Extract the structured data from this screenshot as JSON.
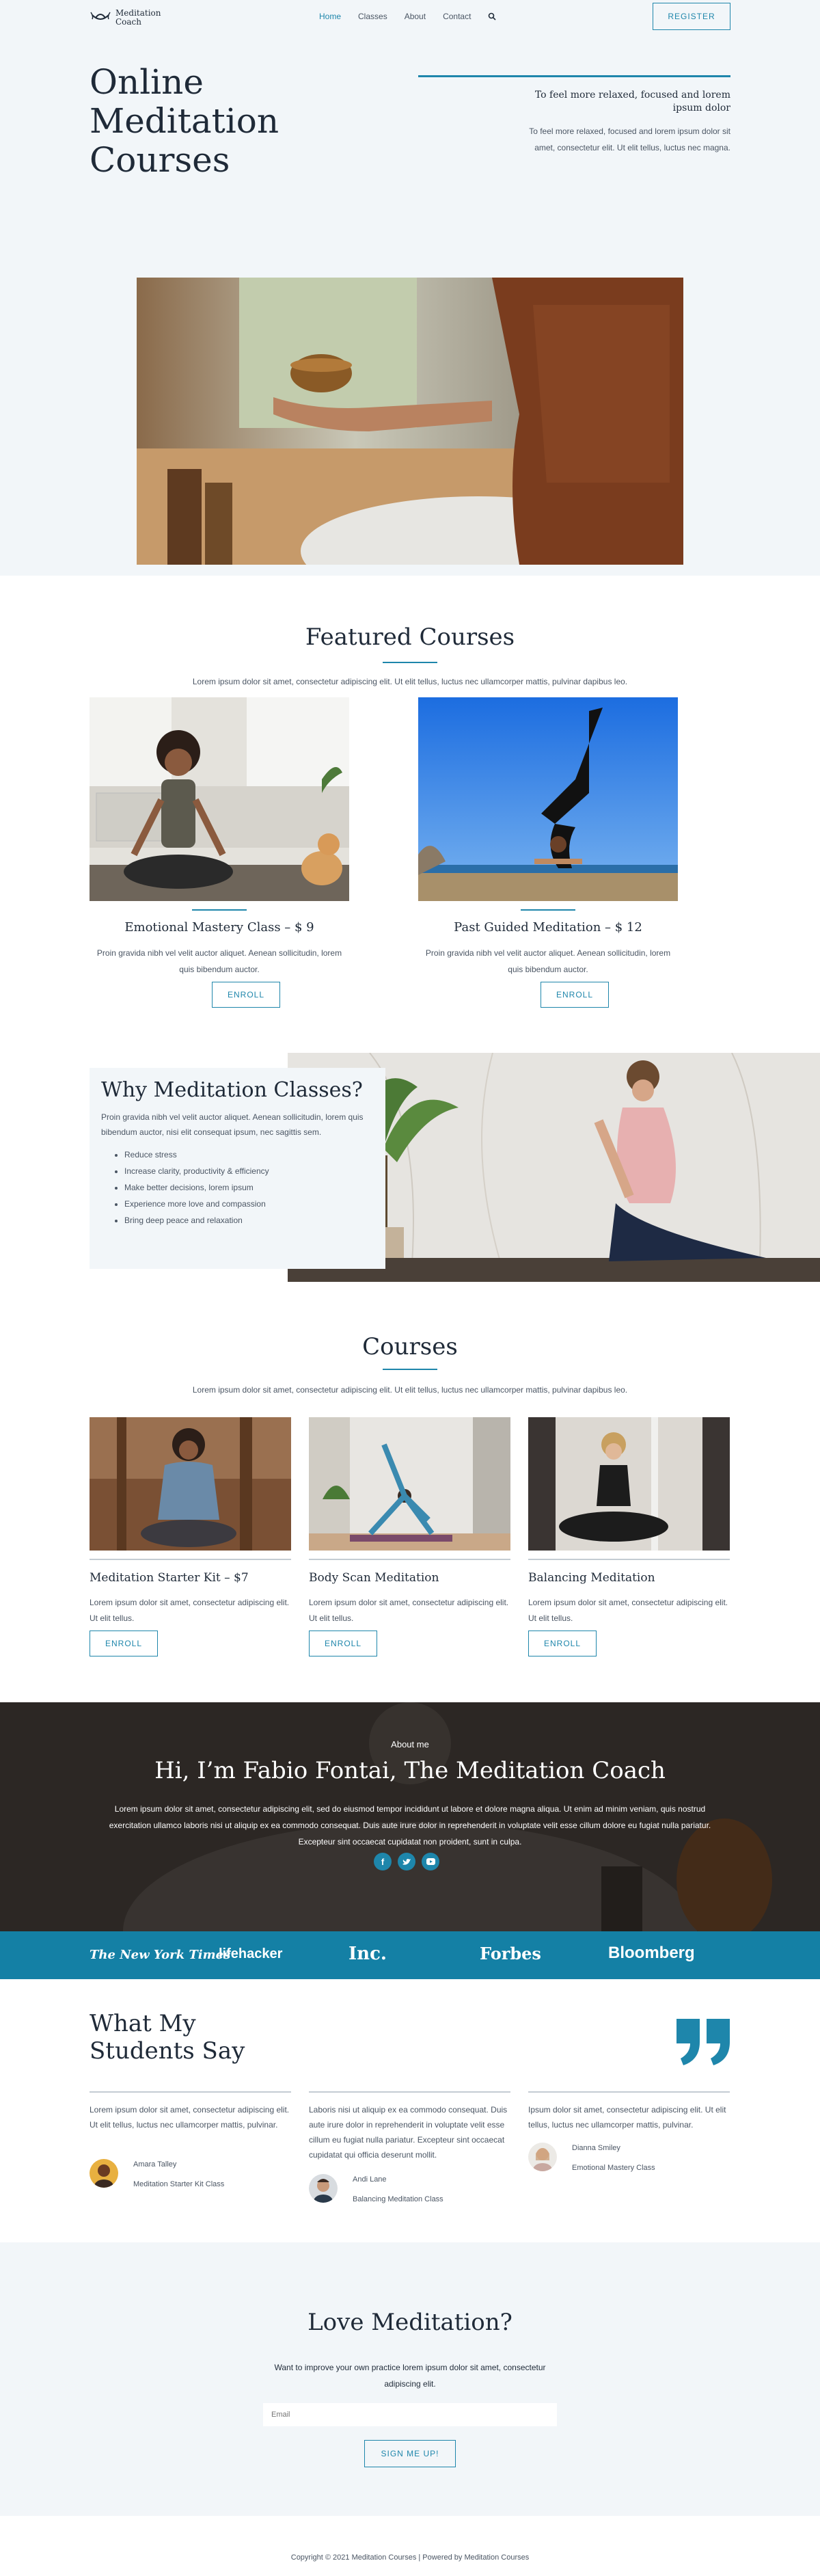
{
  "header": {
    "logo_line1": "Meditation",
    "logo_line2": "Coach",
    "nav": [
      "Home",
      "Classes",
      "About",
      "Contact"
    ],
    "register_label": "REGISTER"
  },
  "hero": {
    "title": "Online Meditation Courses",
    "subtitle": "To feel more relaxed, focused and lorem ipsum dolor",
    "description": "To feel more relaxed, focused and lorem ipsum dolor sit amet, consectetur elit. Ut elit tellus, luctus nec magna."
  },
  "featured": {
    "title": "Featured Courses",
    "text": "Lorem ipsum dolor sit amet, consectetur adipiscing elit. Ut elit tellus, luctus nec ullamcorper mattis, pulvinar dapibus leo.",
    "items": [
      {
        "title": "Emotional Mastery Class – $ 9",
        "desc": "Proin gravida nibh vel velit auctor aliquet. Aenean sollicitudin, lorem quis bibendum auctor.",
        "button": "ENROLL"
      },
      {
        "title": "Past Guided Meditation – $ 12",
        "desc": "Proin gravida nibh vel velit auctor aliquet. Aenean sollicitudin, lorem quis bibendum auctor.",
        "button": "ENROLL"
      }
    ]
  },
  "why": {
    "title": "Why Meditation Classes?",
    "text": "Proin gravida nibh vel velit auctor aliquet. Aenean sollicitudin, lorem quis bibendum auctor, nisi elit consequat ipsum, nec sagittis sem.",
    "list": [
      "Reduce stress",
      "Increase clarity, productivity & efficiency",
      "Make better decisions, lorem ipsum",
      "Experience more love and compassion",
      "Bring deep peace and relaxation"
    ]
  },
  "courses": {
    "title": "Courses",
    "text": "Lorem ipsum dolor sit amet, consectetur adipiscing elit. Ut elit tellus, luctus nec ullamcorper mattis, pulvinar dapibus leo.",
    "items": [
      {
        "title": "Meditation Starter Kit – $7",
        "desc": "Lorem ipsum dolor sit amet, consectetur adipiscing elit. Ut elit tellus.",
        "button": "ENROLL"
      },
      {
        "title": "Body Scan Meditation",
        "desc": "Lorem ipsum dolor sit amet, consectetur adipiscing elit. Ut elit tellus.",
        "button": "ENROLL"
      },
      {
        "title": "Balancing Meditation",
        "desc": "Lorem ipsum dolor sit amet, consectetur adipiscing elit. Ut elit tellus.",
        "button": "ENROLL"
      }
    ]
  },
  "about": {
    "overline": "About me",
    "title": "Hi, I’m Fabio Fontai, The Meditation Coach",
    "text": "Lorem ipsum dolor sit amet, consectetur adipiscing elit, sed do eiusmod tempor incididunt ut labore et dolore magna aliqua. Ut enim ad minim veniam, quis nostrud exercitation ullamco laboris nisi ut aliquip ex ea commodo consequat. Duis aute irure dolor in reprehenderit in voluptate velit esse cillum dolore eu fugiat nulla pariatur. Excepteur sint occaecat cupidatat non proident, sunt in culpa.",
    "socials": [
      "facebook-icon",
      "twitter-icon",
      "youtube-icon"
    ]
  },
  "brands": [
    "The New York Times",
    "lifehacker",
    "Inc.",
    "Forbes",
    "Bloomberg"
  ],
  "testimonials": {
    "title": "What My Students Say",
    "items": [
      {
        "text": "Lorem ipsum dolor sit amet, consectetur adipiscing elit. Ut elit tellus, luctus nec ullamcorper mattis, pulvinar.",
        "name": "Amara Talley",
        "course": "Meditation Starter Kit Class"
      },
      {
        "text": "Laboris nisi ut aliquip ex ea commodo consequat. Duis aute irure dolor in reprehenderit in voluptate velit esse cillum eu fugiat nulla pariatur. Excepteur sint occaecat cupidatat qui officia deserunt mollit.",
        "name": "Andi Lane",
        "course": "Balancing Meditation Class"
      },
      {
        "text": "Ipsum dolor sit amet, consectetur adipiscing elit. Ut elit tellus, luctus nec ullamcorper mattis, pulvinar.",
        "name": "Dianna Smiley",
        "course": "Emotional Mastery Class"
      }
    ]
  },
  "newsletter": {
    "title": "Love Meditation?",
    "text": "Want to improve your own practice lorem ipsum dolor sit amet, consectetur adipiscing elit.",
    "placeholder": "Email",
    "button": "SIGN ME UP!"
  },
  "footer": {
    "text": "Copyright © 2021 Meditation Courses | Powered by Meditation Courses"
  },
  "colors": {
    "accent": "#1e86ab",
    "brand_bar": "#1480a5",
    "background_light": "#f2f6f9",
    "heading": "#1f2a38"
  }
}
